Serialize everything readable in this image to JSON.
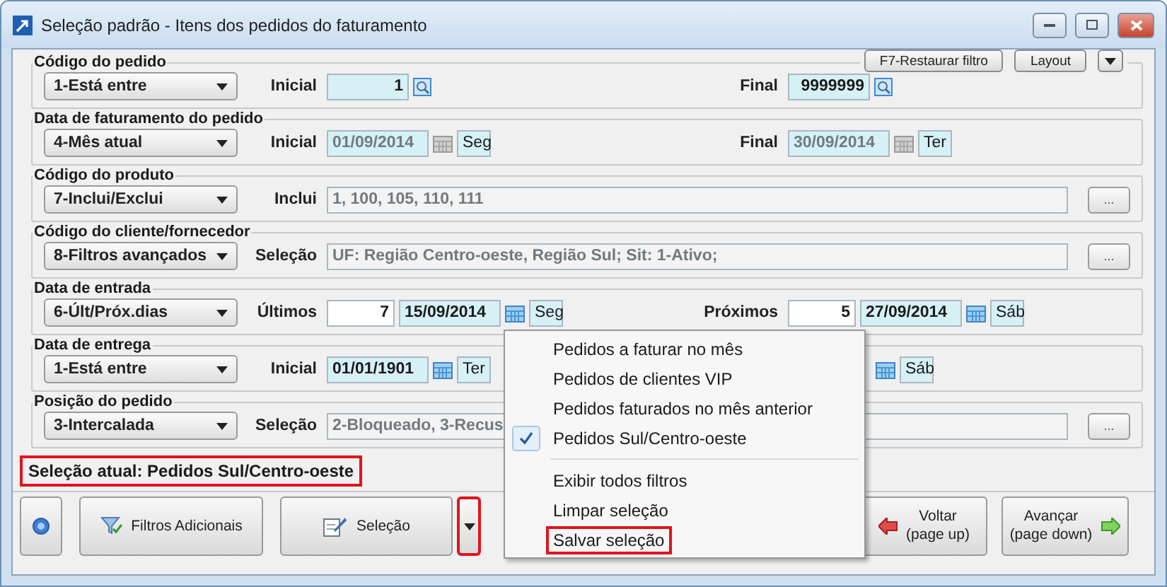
{
  "window": {
    "title": "Seleção padrão - Itens dos pedidos do faturamento"
  },
  "top_buttons": [
    {
      "label": "F7-Restaurar filtro",
      "kind": "text"
    },
    {
      "label": "Layout",
      "kind": "text"
    },
    {
      "kind": "caret"
    }
  ],
  "groups": [
    {
      "legend": "Código do pedido",
      "mode": "1-Está entre",
      "left": [
        {
          "kind": "label",
          "text": "Inicial"
        },
        {
          "kind": "lookup",
          "value": "1",
          "disabled": false
        },
        {
          "kind": "lookup-button"
        }
      ],
      "right": [
        {
          "kind": "label",
          "text": "Final"
        },
        {
          "kind": "lookup",
          "value": "9999999",
          "disabled": false
        },
        {
          "kind": "lookup-button"
        }
      ]
    },
    {
      "legend": "Data de faturamento do pedido",
      "mode": "4-Mês atual",
      "left": [
        {
          "kind": "label",
          "text": "Inicial"
        },
        {
          "kind": "date",
          "value": "01/09/2014",
          "disabled": true
        },
        {
          "kind": "calendar",
          "disabled": true
        },
        {
          "kind": "day",
          "value": "Seg"
        }
      ],
      "right": [
        {
          "kind": "label",
          "text": "Final"
        },
        {
          "kind": "date",
          "value": "30/09/2014",
          "disabled": true
        },
        {
          "kind": "calendar",
          "disabled": true
        },
        {
          "kind": "day",
          "value": "Ter"
        }
      ]
    },
    {
      "legend": "Código do produto",
      "mode": "7-Inclui/Exclui",
      "left": [
        {
          "kind": "label",
          "text": "Inclui"
        },
        {
          "kind": "text",
          "value": "1, 100, 105, 110, 111",
          "disabled": true
        }
      ],
      "action": "..."
    },
    {
      "legend": "Código do cliente/fornecedor",
      "mode": "8-Filtros avançados",
      "left": [
        {
          "kind": "label",
          "text": "Seleção"
        },
        {
          "kind": "text",
          "value": "UF: Região Centro-oeste, Região Sul; Sit: 1-Ativo;",
          "disabled": true
        }
      ],
      "action": "..."
    },
    {
      "legend": "Data de entrada",
      "mode": "6-Últ/Próx.dias",
      "left": [
        {
          "kind": "label",
          "text": "Últimos"
        },
        {
          "kind": "number",
          "value": "7",
          "disabled": false
        },
        {
          "kind": "date",
          "value": "15/09/2014",
          "disabled": false
        },
        {
          "kind": "calendar",
          "disabled": false
        },
        {
          "kind": "day",
          "value": "Seg"
        }
      ],
      "right": [
        {
          "kind": "label",
          "text": "Próximos"
        },
        {
          "kind": "number",
          "value": "5",
          "disabled": false
        },
        {
          "kind": "date",
          "value": "27/09/2014",
          "disabled": false
        },
        {
          "kind": "calendar",
          "disabled": false
        },
        {
          "kind": "day",
          "value": "Sáb"
        }
      ]
    },
    {
      "legend": "Data de entrega",
      "mode": "1-Está entre",
      "left": [
        {
          "kind": "label",
          "text": "Inicial"
        },
        {
          "kind": "date",
          "value": "01/01/1901",
          "disabled": false
        },
        {
          "kind": "calendar",
          "disabled": false
        },
        {
          "kind": "day",
          "value": "Ter"
        }
      ],
      "right": [
        {
          "kind": "covered"
        },
        {
          "kind": "calendar",
          "disabled": false
        },
        {
          "kind": "day",
          "value": "Sáb"
        }
      ]
    },
    {
      "legend": "Posição do pedido",
      "mode": "3-Intercalada",
      "left": [
        {
          "kind": "label",
          "text": "Seleção"
        },
        {
          "kind": "text",
          "value": "2-Bloqueado, 3-Recus",
          "disabled": true
        }
      ],
      "action": "..."
    }
  ],
  "current_selection": {
    "text": "Seleção atual: Pedidos Sul/Centro-oeste",
    "highlighted": true
  },
  "buttons": [
    {
      "kind": "help"
    },
    {
      "kind": "filter",
      "label": "Filtros Adicionais"
    },
    {
      "kind": "selection",
      "label": "Seleção"
    },
    {
      "kind": "split",
      "highlighted": true
    },
    {
      "kind": "back",
      "label": "Voltar",
      "sub": "(page up)"
    },
    {
      "kind": "forward",
      "label": "Avançar",
      "sub": "(page down)"
    }
  ],
  "menu": {
    "sections": [
      [
        {
          "label": "Pedidos a faturar no mês",
          "checked": false,
          "highlighted": false
        },
        {
          "label": "Pedidos de clientes VIP",
          "checked": false,
          "highlighted": false
        },
        {
          "label": "Pedidos faturados no mês anterior",
          "checked": false,
          "highlighted": false
        },
        {
          "label": "Pedidos Sul/Centro-oeste",
          "checked": true,
          "highlighted": false
        }
      ],
      [
        {
          "label": "Exibir todos filtros",
          "checked": false,
          "highlighted": false
        },
        {
          "label": "Limpar seleção",
          "checked": false,
          "highlighted": false
        },
        {
          "label": "Salvar seleção",
          "checked": false,
          "highlighted": true
        }
      ]
    ]
  }
}
